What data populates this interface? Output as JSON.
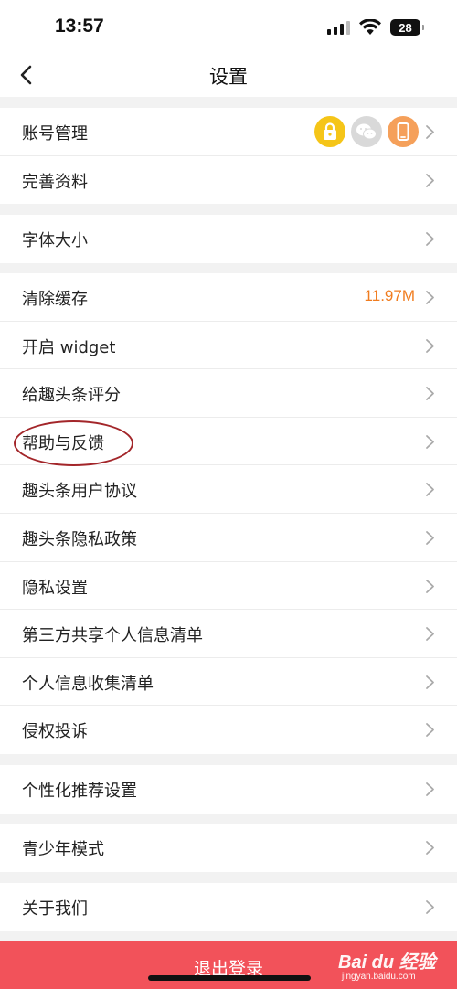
{
  "status": {
    "time": "13:57",
    "battery": "28"
  },
  "nav": {
    "title": "设置"
  },
  "sections": [
    [
      {
        "label": "账号管理",
        "icons": [
          "lock-icon",
          "wechat-icon",
          "phone-icon"
        ]
      },
      {
        "label": "完善资料"
      }
    ],
    [
      {
        "label": "字体大小"
      }
    ],
    [
      {
        "label": "清除缓存",
        "value": "11.97M"
      },
      {
        "label": "开启 widget"
      },
      {
        "label": "给趣头条评分"
      },
      {
        "label": "帮助与反馈"
      },
      {
        "label": "趣头条用户协议"
      },
      {
        "label": "趣头条隐私政策"
      },
      {
        "label": "隐私设置"
      },
      {
        "label": "第三方共享个人信息清单"
      },
      {
        "label": "个人信息收集清单"
      },
      {
        "label": "侵权投诉"
      }
    ],
    [
      {
        "label": "个性化推荐设置"
      }
    ],
    [
      {
        "label": "青少年模式"
      }
    ],
    [
      {
        "label": "关于我们"
      }
    ]
  ],
  "logout": {
    "label": "退出登录"
  },
  "watermark": {
    "brand": "Bai du 经验",
    "url": "jingyan.baidu.com"
  },
  "colors": {
    "accent": "#f07c1f",
    "logout": "#f2525a",
    "lock": "#f5c518",
    "wechat": "#d9d9d9",
    "phone": "#f5a05a",
    "highlight": "#a3262a"
  }
}
